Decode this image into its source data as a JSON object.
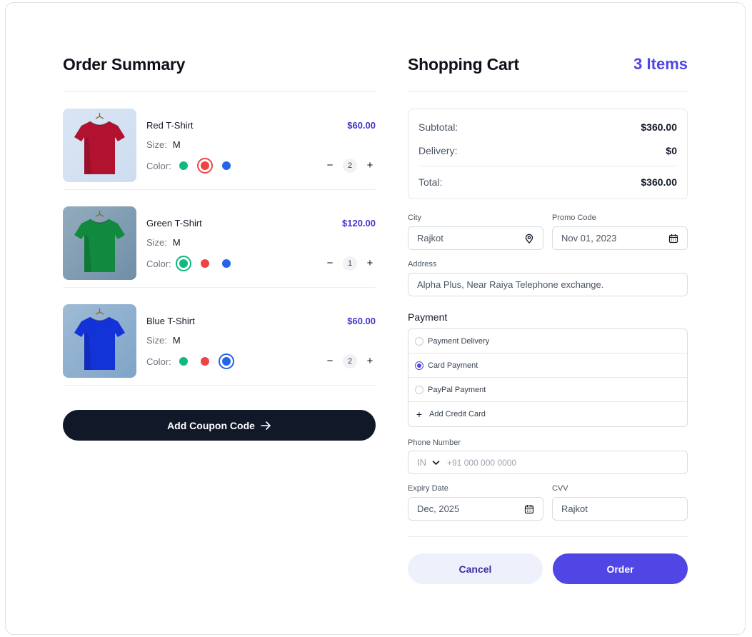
{
  "order_summary": {
    "title": "Order Summary",
    "items": [
      {
        "name": "Red T-Shirt",
        "price": "$60.00",
        "size_label": "Size:",
        "size": "M",
        "color_label": "Color:",
        "selected_color": "red",
        "quantity": "2",
        "shirt_color": "#b0122f",
        "bg_color": "#cdddf0"
      },
      {
        "name": "Green T-Shirt",
        "price": "$120.00",
        "size_label": "Size:",
        "size": "M",
        "color_label": "Color:",
        "selected_color": "green",
        "quantity": "1",
        "shirt_color": "#118a3f",
        "bg_color": "#6f8fa8"
      },
      {
        "name": "Blue T-Shirt",
        "price": "$60.00",
        "size_label": "Size:",
        "size": "M",
        "color_label": "Color:",
        "selected_color": "blue",
        "quantity": "2",
        "shirt_color": "#1233d8",
        "bg_color": "#7fa4c8"
      }
    ],
    "swatch_colors": {
      "green": "#10b981",
      "red": "#ef4444",
      "blue": "#2563eb"
    },
    "coupon_button": "Add Coupon Code"
  },
  "cart": {
    "title": "Shopping Cart",
    "count": "3 Items",
    "subtotal_label": "Subtotal:",
    "subtotal": "$360.00",
    "delivery_label": "Delivery:",
    "delivery": "$0",
    "total_label": "Total:",
    "total": "$360.00"
  },
  "form": {
    "city_label": "City",
    "city_value": "Rajkot",
    "promo_label": "Promo Code",
    "promo_value": "Nov 01, 2023",
    "address_label": "Address",
    "address_value": "Alpha Plus, Near Raiya Telephone exchange.",
    "payment_title": "Payment",
    "payment_options": [
      "Payment Delivery",
      "Card Payment",
      "PayPal Payment"
    ],
    "selected_payment": "Card Payment",
    "add_card": "Add Credit Card",
    "phone_label": "Phone Number",
    "phone_country": "IN",
    "phone_placeholder": "+91 000 000 0000",
    "expiry_label": "Expiry Date",
    "expiry_value": "Dec, 2025",
    "cvv_label": "CVV",
    "cvv_value": "Rajkot"
  },
  "actions": {
    "cancel": "Cancel",
    "order": "Order"
  },
  "colors": {
    "accent": "#4f46e5",
    "dark_button": "#111827",
    "price": "#4338ca"
  }
}
